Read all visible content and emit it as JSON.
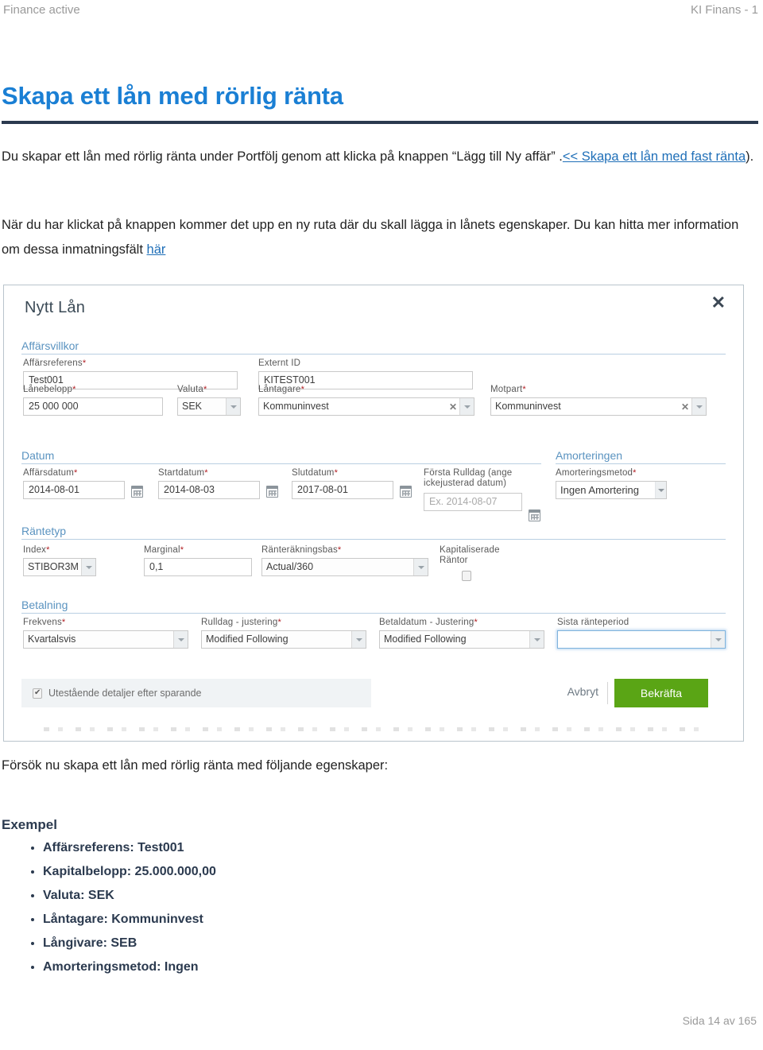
{
  "running_header": {
    "left": "Finance active",
    "right": "KI Finans - 1"
  },
  "page": {
    "title": "Skapa ett lån med rörlig ränta",
    "paragraph1_before": "Du skapar ett lån med rörlig ränta under Portfölj genom att klicka på knappen “Lägg till Ny affär” .",
    "paragraph1_link": "<< Skapa ett lån med fast ränta",
    "paragraph1_after": ").",
    "paragraph2_before": "När du har klickat på knappen kommer det upp en ny ruta där du skall lägga in lånets egenskaper. Du kan hitta mer information om dessa inmatningsfält ",
    "paragraph2_link": "här",
    "paragraph3": "Försök nu skapa ett lån med rörlig ränta med följande egenskaper:",
    "exempel_heading": "Exempel",
    "exempel_items": [
      "Affärsreferens: Test001",
      "Kapitalbelopp: 25.000.000,00",
      "Valuta: SEK",
      "Låntagare: Kommuninvest",
      "Långivare: SEB",
      "Amorteringsmetod: Ingen"
    ],
    "footer": "Sida 14 av 165"
  },
  "dialog": {
    "title": "Nytt Lån",
    "close_icon": "close-icon",
    "sections": {
      "affarsvillkor": "Affärsvillkor",
      "datum": "Datum",
      "amorteringen": "Amorteringen",
      "rantetyp": "Räntetyp",
      "betalning": "Betalning"
    },
    "fields": {
      "affarsreferens": {
        "label": "Affärsreferens",
        "required": "*",
        "value": "Test001"
      },
      "externt_id": {
        "label": "Externt ID",
        "required": "",
        "value": "KITEST001"
      },
      "lanebelopp": {
        "label": "Lånebelopp",
        "required": "*",
        "value": "25 000 000"
      },
      "valuta": {
        "label": "Valuta",
        "required": "*",
        "value": "SEK"
      },
      "lantagare": {
        "label": "Låntagare",
        "required": "*",
        "value": "Kommuninvest",
        "clear_icon": "clear-x-icon"
      },
      "motpart": {
        "label": "Motpart",
        "required": "*",
        "value": "Kommuninvest",
        "clear_icon": "clear-x-icon"
      },
      "affarsdatum": {
        "label": "Affärsdatum",
        "required": "*",
        "value": "2014-08-01",
        "icon": "calendar-icon"
      },
      "startdatum": {
        "label": "Startdatum",
        "required": "*",
        "value": "2014-08-03",
        "icon": "calendar-icon"
      },
      "slutdatum": {
        "label": "Slutdatum",
        "required": "*",
        "value": "2017-08-01",
        "icon": "calendar-icon"
      },
      "forsta_rulldag": {
        "label_line1": "Första Rulldag (ange",
        "label_line2": "ickejusterad datum)",
        "required": "",
        "placeholder": "Ex. 2014-08-07",
        "icon": "calendar-icon"
      },
      "amorteringsmetod": {
        "label": "Amorteringsmetod",
        "required": "*",
        "value": "Ingen Amortering"
      },
      "index": {
        "label": "Index",
        "required": "*",
        "value": "STIBOR3M"
      },
      "marginal": {
        "label": "Marginal",
        "required": "*",
        "value": "0,1"
      },
      "ranterakningsbas": {
        "label": "Ränteräkningsbas",
        "required": "*",
        "value": "Actual/360"
      },
      "kapitaliserade": {
        "label_line1": "Kapitaliserade",
        "label_line2": "Räntor",
        "checked": false
      },
      "frekvens": {
        "label": "Frekvens",
        "required": "*",
        "value": "Kvartalsvis"
      },
      "rulldag_justering": {
        "label": "Rulldag - justering",
        "required": "*",
        "value": "Modified Following"
      },
      "betaldatum_justering": {
        "label": "Betaldatum - Justering",
        "required": "*",
        "value": "Modified Following"
      },
      "sista_ranteperiod": {
        "label": "Sista ränteperiod",
        "required": "",
        "value": ""
      }
    },
    "footer": {
      "save_details_label": "Utestående detaljer efter sparande",
      "save_details_checked": true,
      "cancel_label": "Avbryt",
      "confirm_label": "Bekräfta",
      "confirm_color": "#5aa515"
    }
  }
}
